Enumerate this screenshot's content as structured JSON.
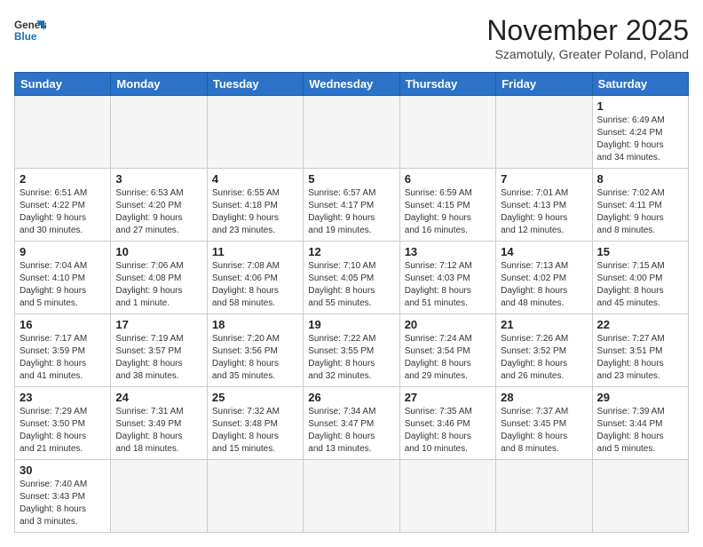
{
  "logo": {
    "line1": "General",
    "line2": "Blue"
  },
  "title": "November 2025",
  "subtitle": "Szamotuly, Greater Poland, Poland",
  "days_of_week": [
    "Sunday",
    "Monday",
    "Tuesday",
    "Wednesday",
    "Thursday",
    "Friday",
    "Saturday"
  ],
  "weeks": [
    [
      {
        "day": "",
        "info": ""
      },
      {
        "day": "",
        "info": ""
      },
      {
        "day": "",
        "info": ""
      },
      {
        "day": "",
        "info": ""
      },
      {
        "day": "",
        "info": ""
      },
      {
        "day": "",
        "info": ""
      },
      {
        "day": "1",
        "info": "Sunrise: 6:49 AM\nSunset: 4:24 PM\nDaylight: 9 hours\nand 34 minutes."
      }
    ],
    [
      {
        "day": "2",
        "info": "Sunrise: 6:51 AM\nSunset: 4:22 PM\nDaylight: 9 hours\nand 30 minutes."
      },
      {
        "day": "3",
        "info": "Sunrise: 6:53 AM\nSunset: 4:20 PM\nDaylight: 9 hours\nand 27 minutes."
      },
      {
        "day": "4",
        "info": "Sunrise: 6:55 AM\nSunset: 4:18 PM\nDaylight: 9 hours\nand 23 minutes."
      },
      {
        "day": "5",
        "info": "Sunrise: 6:57 AM\nSunset: 4:17 PM\nDaylight: 9 hours\nand 19 minutes."
      },
      {
        "day": "6",
        "info": "Sunrise: 6:59 AM\nSunset: 4:15 PM\nDaylight: 9 hours\nand 16 minutes."
      },
      {
        "day": "7",
        "info": "Sunrise: 7:01 AM\nSunset: 4:13 PM\nDaylight: 9 hours\nand 12 minutes."
      },
      {
        "day": "8",
        "info": "Sunrise: 7:02 AM\nSunset: 4:11 PM\nDaylight: 9 hours\nand 8 minutes."
      }
    ],
    [
      {
        "day": "9",
        "info": "Sunrise: 7:04 AM\nSunset: 4:10 PM\nDaylight: 9 hours\nand 5 minutes."
      },
      {
        "day": "10",
        "info": "Sunrise: 7:06 AM\nSunset: 4:08 PM\nDaylight: 9 hours\nand 1 minute."
      },
      {
        "day": "11",
        "info": "Sunrise: 7:08 AM\nSunset: 4:06 PM\nDaylight: 8 hours\nand 58 minutes."
      },
      {
        "day": "12",
        "info": "Sunrise: 7:10 AM\nSunset: 4:05 PM\nDaylight: 8 hours\nand 55 minutes."
      },
      {
        "day": "13",
        "info": "Sunrise: 7:12 AM\nSunset: 4:03 PM\nDaylight: 8 hours\nand 51 minutes."
      },
      {
        "day": "14",
        "info": "Sunrise: 7:13 AM\nSunset: 4:02 PM\nDaylight: 8 hours\nand 48 minutes."
      },
      {
        "day": "15",
        "info": "Sunrise: 7:15 AM\nSunset: 4:00 PM\nDaylight: 8 hours\nand 45 minutes."
      }
    ],
    [
      {
        "day": "16",
        "info": "Sunrise: 7:17 AM\nSunset: 3:59 PM\nDaylight: 8 hours\nand 41 minutes."
      },
      {
        "day": "17",
        "info": "Sunrise: 7:19 AM\nSunset: 3:57 PM\nDaylight: 8 hours\nand 38 minutes."
      },
      {
        "day": "18",
        "info": "Sunrise: 7:20 AM\nSunset: 3:56 PM\nDaylight: 8 hours\nand 35 minutes."
      },
      {
        "day": "19",
        "info": "Sunrise: 7:22 AM\nSunset: 3:55 PM\nDaylight: 8 hours\nand 32 minutes."
      },
      {
        "day": "20",
        "info": "Sunrise: 7:24 AM\nSunset: 3:54 PM\nDaylight: 8 hours\nand 29 minutes."
      },
      {
        "day": "21",
        "info": "Sunrise: 7:26 AM\nSunset: 3:52 PM\nDaylight: 8 hours\nand 26 minutes."
      },
      {
        "day": "22",
        "info": "Sunrise: 7:27 AM\nSunset: 3:51 PM\nDaylight: 8 hours\nand 23 minutes."
      }
    ],
    [
      {
        "day": "23",
        "info": "Sunrise: 7:29 AM\nSunset: 3:50 PM\nDaylight: 8 hours\nand 21 minutes."
      },
      {
        "day": "24",
        "info": "Sunrise: 7:31 AM\nSunset: 3:49 PM\nDaylight: 8 hours\nand 18 minutes."
      },
      {
        "day": "25",
        "info": "Sunrise: 7:32 AM\nSunset: 3:48 PM\nDaylight: 8 hours\nand 15 minutes."
      },
      {
        "day": "26",
        "info": "Sunrise: 7:34 AM\nSunset: 3:47 PM\nDaylight: 8 hours\nand 13 minutes."
      },
      {
        "day": "27",
        "info": "Sunrise: 7:35 AM\nSunset: 3:46 PM\nDaylight: 8 hours\nand 10 minutes."
      },
      {
        "day": "28",
        "info": "Sunrise: 7:37 AM\nSunset: 3:45 PM\nDaylight: 8 hours\nand 8 minutes."
      },
      {
        "day": "29",
        "info": "Sunrise: 7:39 AM\nSunset: 3:44 PM\nDaylight: 8 hours\nand 5 minutes."
      }
    ],
    [
      {
        "day": "30",
        "info": "Sunrise: 7:40 AM\nSunset: 3:43 PM\nDaylight: 8 hours\nand 3 minutes."
      },
      {
        "day": "",
        "info": ""
      },
      {
        "day": "",
        "info": ""
      },
      {
        "day": "",
        "info": ""
      },
      {
        "day": "",
        "info": ""
      },
      {
        "day": "",
        "info": ""
      },
      {
        "day": "",
        "info": ""
      }
    ]
  ]
}
